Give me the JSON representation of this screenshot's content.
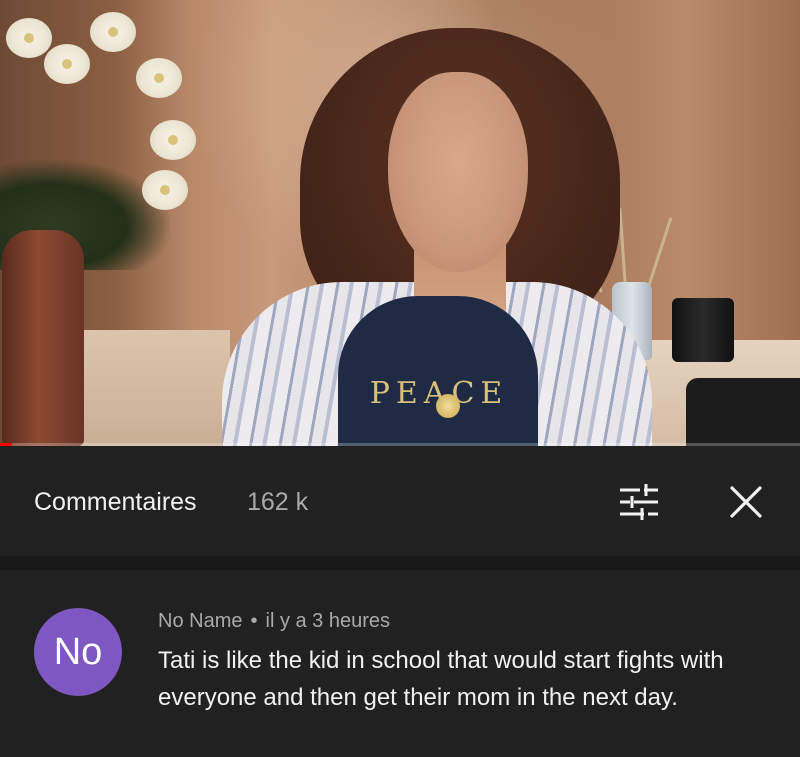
{
  "video": {
    "shirt_print": "PEACE",
    "progress_fraction": 0.015
  },
  "comments_header": {
    "title": "Commentaires",
    "count": "162 k",
    "sort_icon": "sort-filter-icon",
    "close_icon": "close-icon"
  },
  "comment": {
    "avatar_text": "No",
    "avatar_color": "#7e57c2",
    "author": "No Name",
    "separator": "•",
    "time": "il y a 3 heures",
    "text": "Tati is like the kid in school that would start fights with everyone and then get their mom in the next day."
  },
  "colors": {
    "background": "#212121",
    "text_primary": "#f1f1f1",
    "text_secondary": "#aaaaaa",
    "progress": "#ff0000"
  }
}
